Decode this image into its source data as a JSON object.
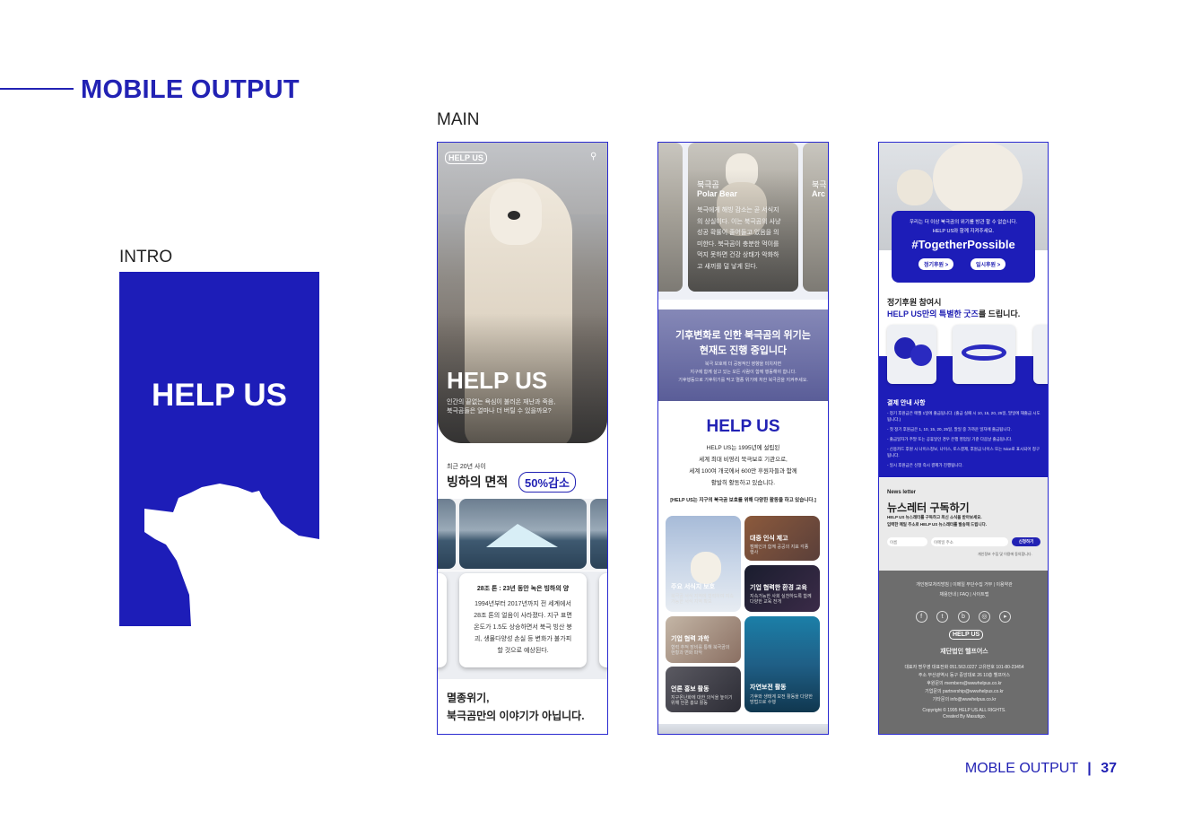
{
  "page": {
    "title": "MOBILE OUTPUT",
    "intro_label": "INTRO",
    "main_label": "MAIN",
    "footer_label": "MOBLE OUTPUT",
    "footer_divider": "|",
    "page_number": "37",
    "accent": "#2222b4"
  },
  "intro": {
    "title": "HELP US"
  },
  "phone1": {
    "logo": "HELP US",
    "hero_title": "HELP US",
    "hero_sub": "인간의 끝없는 욕심이 불러온 재난과 죽음,\n북극곰들은 얼마나 더 버틸 수 있을까요?",
    "stat_caption": "최근 20년 사이",
    "stat_heading": "빙하의 면적",
    "stat_pill": "50%감소",
    "card_title": "28조 톤 : 23년 동안 녹은 빙하의 양",
    "card_body": [
      "1994년부터 2017년까지 전 세계에서",
      "28조 톤의 얼음이 사라졌다. 지구 표면",
      "온도가 1.5도 상승하면서 북극 빙산 붕",
      "괴, 생물다양성 손실 등 변화가 불가피",
      "할 것으로 예상된다."
    ],
    "bottom_line1": "멸종위기,",
    "bottom_line2": "북극곰만의 이야기가 아닙니다."
  },
  "phone2": {
    "card_title_kr": "북극곰",
    "card_title_en": "Polar Bear",
    "card_body": [
      "북극에게 해빙 감소는 곧 서식지",
      "의 상실이다. 이는 북극곰의 사냥",
      "성공 확률이 줄어들고 있음을 의",
      "미한다. 북극곰이 충분한 먹이를",
      "먹지 못하면 건강 상태가 악화하",
      "고 새끼를 덜 낳게 된다."
    ],
    "side_card_kr": "북극",
    "side_card_en": "Arc",
    "band_line1": "기후변화로 인한 북극곰의 위기는",
    "band_line2": "현재도 진행 중입니다",
    "band_small": [
      "북극 보호에 더 공정적인 영향을 미치자면",
      "지구에 함께 살고 있는 모든 사람이 함께 행동해야 합니다.",
      "기후행동으로 기후위기를 막고 멸종 위기에 처한 북극곰을 지켜주세요."
    ],
    "org_title": "HELP US",
    "org_body": [
      "HELP US는 1995년에 설립된",
      "세계 최대 비영리 북극보호 기관으로,",
      "세계 100여 개국에서 600만 후원자들과 함께",
      "활발히 활동하고 있습니다."
    ],
    "org_note": "[HELP US는 지구의 북극곰 보호를 위해 다양한 활동을 하고 있습니다.]",
    "grid": [
      {
        "label": "주요 서식지 보호",
        "sub": "북극곰 서식 지역에 협력하여 지속 가능한 서식 지역 확보"
      },
      {
        "label": "대중 인식 제고",
        "sub": "캠페인과 함께 공공의 지표 각종 행사"
      },
      {
        "label": "기업 협력 과학",
        "sub": "협력 추적 장비를 통해 북극곰의 현황과 변화 파악"
      },
      {
        "label": "기업 협력한 환경 교육",
        "sub": "지속가능한 사회 실천하도록 함께 다양한 교육 전개"
      },
      {
        "label": "언론 홍보 활동",
        "sub": "지구온난화에 대한 의식을 높이기 위해 언론 홍보 활동"
      },
      {
        "label": "자연보전 활동",
        "sub": "기후와 생태계 보전 활동을 다양한 방법으로 수행"
      }
    ]
  },
  "phone3": {
    "banner_line1": "우리는 더 이상 북극곰의 위기를 방관 할 수 없습니다.",
    "banner_line2": "HELP US와 함께 지켜주세요.",
    "hashtag": "#TogetherPossible",
    "btn_regular": "정기후원 >",
    "btn_once": "일시후원 >",
    "goods_title1": "정기후원 참여시",
    "goods_title2_pre": "HELP US만의",
    "goods_title2_hl": "특별한 굿즈",
    "goods_title2_post": "를 드립니다.",
    "pay_title": "결제 안내 사항",
    "pay_items": [
      "- 정기 후원금은 매월 1일에 출금됩니다. (출금 실패 시 10, 15, 20, 25일, 말일에 재출금 시도 됩니다.)",
      "- 첫 정기 후원금은 1, 10, 15, 20, 25일, 말일 중 가까운 일자에 출금됩니다.",
      "- 출금일자가 주말 또는 공휴일인 경우 은행 영업일 기준 다음날 출금됩니다.",
      "- 신용카드 후원 시 나이스정보, 나이스, 토스결제, 후원금 나이스 또는 Nice로 표시되어 청구됩니다.",
      "- 일시 후원금은 신청 즉시 결제가 진행됩니다."
    ],
    "news_label": "News letter",
    "news_title": "뉴스레터 구독하기",
    "news_desc1": "HELP US 뉴스레터를 구독하고 최신 소식을 받아보세요.",
    "news_desc2": "입력한 메일 주소로 HELP US 뉴스레터를 발송해 드립니다.",
    "name_placeholder": "이름",
    "email_placeholder": "이메일 주소",
    "subscribe_btn": "신청하기",
    "consent": "개인정보 수집 및 이용에 동의합니다.",
    "footer_links1": "개인정보처리방침 | 이메일 무단수집 거부 | 이용약관",
    "footer_links2": "채용안내 | FAQ | 사이트맵",
    "footer_logo": "HELP US",
    "footer_org": "재단법인 헬프어스",
    "footer_info": [
      "대표자 명우영  대표전화 051.563.0227  고유번호 101-80-23454",
      "주소 부산광역시 동구 중앙대로 26 10층 헬프어스",
      "후원문의 members@wwwhelpus.co.kr",
      "기업문의 partnership@wwwhelpus.co.kr",
      "기타문의 info@wwwhelpus.co.kr"
    ],
    "copyright1": "Copyright © 1995 HELP US ALL RIGHTS.",
    "copyright2": "Created By Masutigo."
  }
}
